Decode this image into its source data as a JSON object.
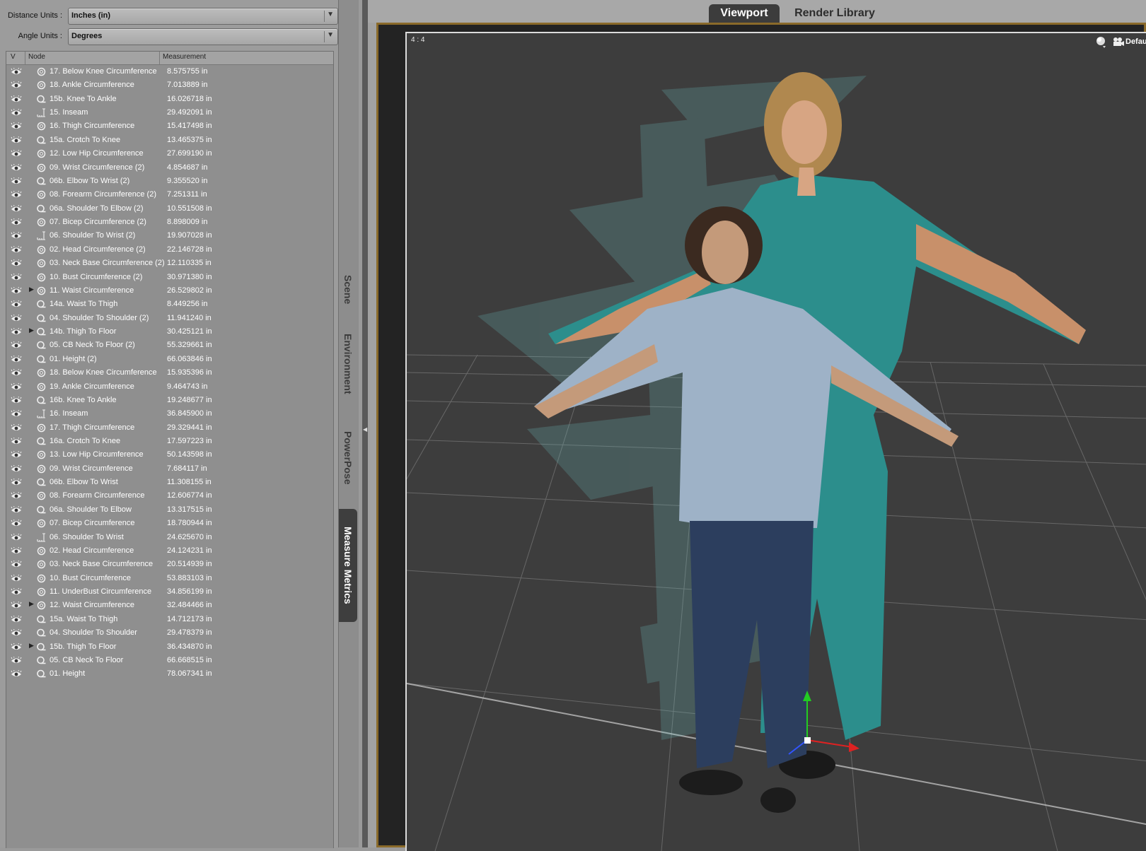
{
  "units": {
    "distance_label": "Distance Units :",
    "distance_value": "Inches (in)",
    "angle_label": "Angle Units :",
    "angle_value": "Degrees"
  },
  "table": {
    "columns": [
      "V",
      "Node",
      "Measurement"
    ],
    "rows": [
      {
        "name": "17. Below Knee Circumference",
        "value": "8.575755 in",
        "icon": "circumference-icon",
        "expand": false
      },
      {
        "name": "18. Ankle Circumference",
        "value": "7.013889 in",
        "icon": "circumference-icon",
        "expand": false
      },
      {
        "name": "15b. Knee To Ankle",
        "value": "16.026718 in",
        "icon": "tape-icon",
        "expand": false
      },
      {
        "name": "15. Inseam",
        "value": "29.492091 in",
        "icon": "ruler-icon",
        "expand": false
      },
      {
        "name": "16. Thigh Circumference",
        "value": "15.417498 in",
        "icon": "circumference-icon",
        "expand": false
      },
      {
        "name": "15a. Crotch To Knee",
        "value": "13.465375 in",
        "icon": "tape-icon",
        "expand": false
      },
      {
        "name": "12. Low Hip Circumference",
        "value": "27.699190 in",
        "icon": "circumference-icon",
        "expand": false
      },
      {
        "name": "09. Wrist Circumference (2)",
        "value": "4.854687 in",
        "icon": "circumference-icon",
        "expand": false
      },
      {
        "name": "06b. Elbow To Wrist (2)",
        "value": "9.355520 in",
        "icon": "tape-icon",
        "expand": false
      },
      {
        "name": "08. Forearm Circumference (2)",
        "value": "7.251311 in",
        "icon": "circumference-icon",
        "expand": false
      },
      {
        "name": "06a. Shoulder To Elbow (2)",
        "value": "10.551508 in",
        "icon": "tape-icon",
        "expand": false
      },
      {
        "name": "07. Bicep Circumference (2)",
        "value": "8.898009 in",
        "icon": "circumference-icon",
        "expand": false
      },
      {
        "name": "06. Shoulder To Wrist (2)",
        "value": "19.907028 in",
        "icon": "ruler-icon",
        "expand": false
      },
      {
        "name": "02. Head Circumference (2)",
        "value": "22.146728 in",
        "icon": "circumference-icon",
        "expand": false
      },
      {
        "name": "03. Neck Base Circumference (2)",
        "value": "12.110335 in",
        "icon": "circumference-icon",
        "expand": false
      },
      {
        "name": "10. Bust Circumference (2)",
        "value": "30.971380 in",
        "icon": "circumference-icon",
        "expand": false
      },
      {
        "name": "11. Waist Circumference",
        "value": "26.529802 in",
        "icon": "circumference-icon",
        "expand": true
      },
      {
        "name": "14a. Waist To Thigh",
        "value": "8.449256 in",
        "icon": "tape-icon",
        "expand": false
      },
      {
        "name": "04. Shoulder To Shoulder (2)",
        "value": "11.941240 in",
        "icon": "tape-icon",
        "expand": false
      },
      {
        "name": "14b. Thigh To Floor",
        "value": "30.425121 in",
        "icon": "tape-icon",
        "expand": true
      },
      {
        "name": "05. CB Neck To Floor (2)",
        "value": "55.329661 in",
        "icon": "tape-icon",
        "expand": false
      },
      {
        "name": "01. Height (2)",
        "value": "66.063846 in",
        "icon": "tape-icon",
        "expand": false
      },
      {
        "name": "18. Below Knee Circumference",
        "value": "15.935396 in",
        "icon": "circumference-icon",
        "expand": false
      },
      {
        "name": "19. Ankle Circumference",
        "value": "9.464743 in",
        "icon": "circumference-icon",
        "expand": false
      },
      {
        "name": "16b. Knee To Ankle",
        "value": "19.248677 in",
        "icon": "tape-icon",
        "expand": false
      },
      {
        "name": "16. Inseam",
        "value": "36.845900 in",
        "icon": "ruler-icon",
        "expand": false
      },
      {
        "name": "17. Thigh Circumference",
        "value": "29.329441 in",
        "icon": "circumference-icon",
        "expand": false
      },
      {
        "name": "16a. Crotch To Knee",
        "value": "17.597223 in",
        "icon": "tape-icon",
        "expand": false
      },
      {
        "name": "13. Low Hip Circumference",
        "value": "50.143598 in",
        "icon": "circumference-icon",
        "expand": false
      },
      {
        "name": "09. Wrist Circumference",
        "value": "7.684117 in",
        "icon": "circumference-icon",
        "expand": false
      },
      {
        "name": "06b. Elbow To Wrist",
        "value": "11.308155 in",
        "icon": "tape-icon",
        "expand": false
      },
      {
        "name": "08. Forearm Circumference",
        "value": "12.606774 in",
        "icon": "circumference-icon",
        "expand": false
      },
      {
        "name": "06a. Shoulder To Elbow",
        "value": "13.317515 in",
        "icon": "tape-icon",
        "expand": false
      },
      {
        "name": "07. Bicep Circumference",
        "value": "18.780944 in",
        "icon": "circumference-icon",
        "expand": false
      },
      {
        "name": "06. Shoulder To Wrist",
        "value": "24.625670 in",
        "icon": "ruler-icon",
        "expand": false
      },
      {
        "name": "02. Head Circumference",
        "value": "24.124231 in",
        "icon": "circumference-icon",
        "expand": false
      },
      {
        "name": "03. Neck Base Circumference",
        "value": "20.514939 in",
        "icon": "circumference-icon",
        "expand": false
      },
      {
        "name": "10. Bust Circumference",
        "value": "53.883103 in",
        "icon": "circumference-icon",
        "expand": false
      },
      {
        "name": "11. UnderBust Circumference",
        "value": "34.856199 in",
        "icon": "circumference-icon",
        "expand": false
      },
      {
        "name": "12. Waist Circumference",
        "value": "32.484466 in",
        "icon": "circumference-icon",
        "expand": true
      },
      {
        "name": "15a. Waist To Thigh",
        "value": "14.712173 in",
        "icon": "tape-icon",
        "expand": false
      },
      {
        "name": "04. Shoulder To Shoulder",
        "value": "29.478379 in",
        "icon": "tape-icon",
        "expand": false
      },
      {
        "name": "15b. Thigh To Floor",
        "value": "36.434870 in",
        "icon": "tape-icon",
        "expand": true
      },
      {
        "name": "05. CB Neck To Floor",
        "value": "66.668515 in",
        "icon": "tape-icon",
        "expand": false
      },
      {
        "name": "01. Height",
        "value": "78.067341 in",
        "icon": "tape-icon",
        "expand": false
      }
    ]
  },
  "side_tabs": [
    {
      "label": "Scene",
      "active": false
    },
    {
      "label": "Environment",
      "active": false
    },
    {
      "label": "PowerPose",
      "active": false
    },
    {
      "label": "Measure Metrics",
      "active": true
    }
  ],
  "viewport": {
    "tabs": [
      {
        "label": "Viewport",
        "active": true
      },
      {
        "label": "Render Library",
        "active": false
      }
    ],
    "aspect": "4 : 4",
    "camera": "Defaul",
    "accent": "#8a6a2a"
  }
}
